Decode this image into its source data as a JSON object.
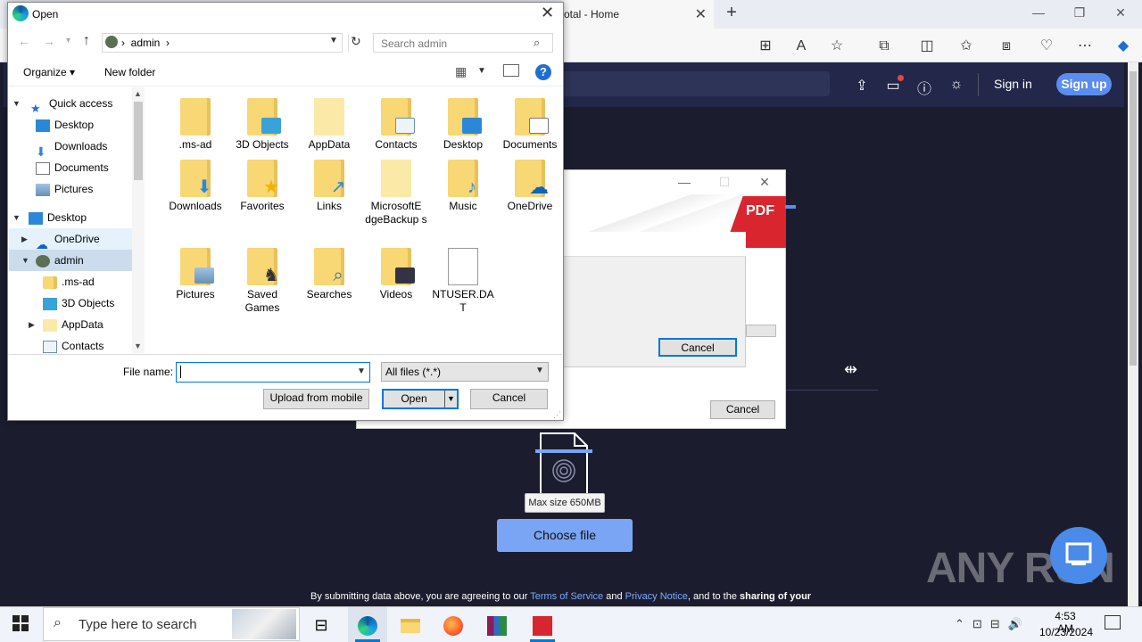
{
  "browser": {
    "tab_title": "otal - Home",
    "tab_close": "✕",
    "new_tab": "+",
    "win_min": "—",
    "win_max": "❐",
    "win_close": "✕"
  },
  "site": {
    "sign_in": "Sign in",
    "sign_up": "Sign up",
    "max_size": "Max size 650MB",
    "choose_file": "Choose file",
    "terms_pre": "By submitting data above, you are agreeing to our ",
    "terms_link": "Terms of Service",
    "terms_and": " and ",
    "privacy_link": "Privacy Notice",
    "terms_post": ", and to the ",
    "sharing": "sharing of your"
  },
  "watermark": "ANY RUN",
  "pdf_app": {
    "logo_text": "PDF",
    "inner_cancel": "Cancel",
    "cancel": "Cancel"
  },
  "dialog": {
    "title": "Open",
    "path": [
      "admin"
    ],
    "search_placeholder": "Search admin",
    "organize": "Organize ▾",
    "new_folder": "New folder",
    "help": "?",
    "nav": [
      {
        "label": "Quick access",
        "pinned": false
      },
      {
        "label": "Desktop",
        "pinned": true
      },
      {
        "label": "Downloads",
        "pinned": true
      },
      {
        "label": "Documents",
        "pinned": true
      },
      {
        "label": "Pictures",
        "pinned": true
      },
      {
        "label": "Desktop",
        "pinned": false
      },
      {
        "label": "OneDrive",
        "pinned": false
      },
      {
        "label": "admin",
        "pinned": false
      },
      {
        "label": ".ms-ad",
        "pinned": false
      },
      {
        "label": "3D Objects",
        "pinned": false
      },
      {
        "label": "AppData",
        "pinned": false
      },
      {
        "label": "Contacts",
        "pinned": false
      }
    ],
    "files": [
      {
        "name": ".ms-ad"
      },
      {
        "name": "3D Objects"
      },
      {
        "name": "AppData"
      },
      {
        "name": "Contacts"
      },
      {
        "name": "Desktop"
      },
      {
        "name": "Documents"
      },
      {
        "name": "Downloads"
      },
      {
        "name": "Favorites"
      },
      {
        "name": "Links"
      },
      {
        "name": "MicrosoftEdgeBackups",
        "display": "MicrosoftE dgeBackup s"
      },
      {
        "name": "Music"
      },
      {
        "name": "OneDrive"
      },
      {
        "name": "Pictures"
      },
      {
        "name": "Saved Games"
      },
      {
        "name": "Searches"
      },
      {
        "name": "Videos"
      },
      {
        "name": "NTUSER.DAT",
        "display": "NTUSER.DA T"
      }
    ],
    "file_name_label": "File name:",
    "file_name_value": "",
    "filter": "All files (*.*)",
    "upload_from_mobile": "Upload from mobile",
    "open": "Open",
    "cancel": "Cancel"
  },
  "taskbar": {
    "search_placeholder": "Type here to search",
    "time": "4:53 AM",
    "date": "10/23/2024"
  }
}
